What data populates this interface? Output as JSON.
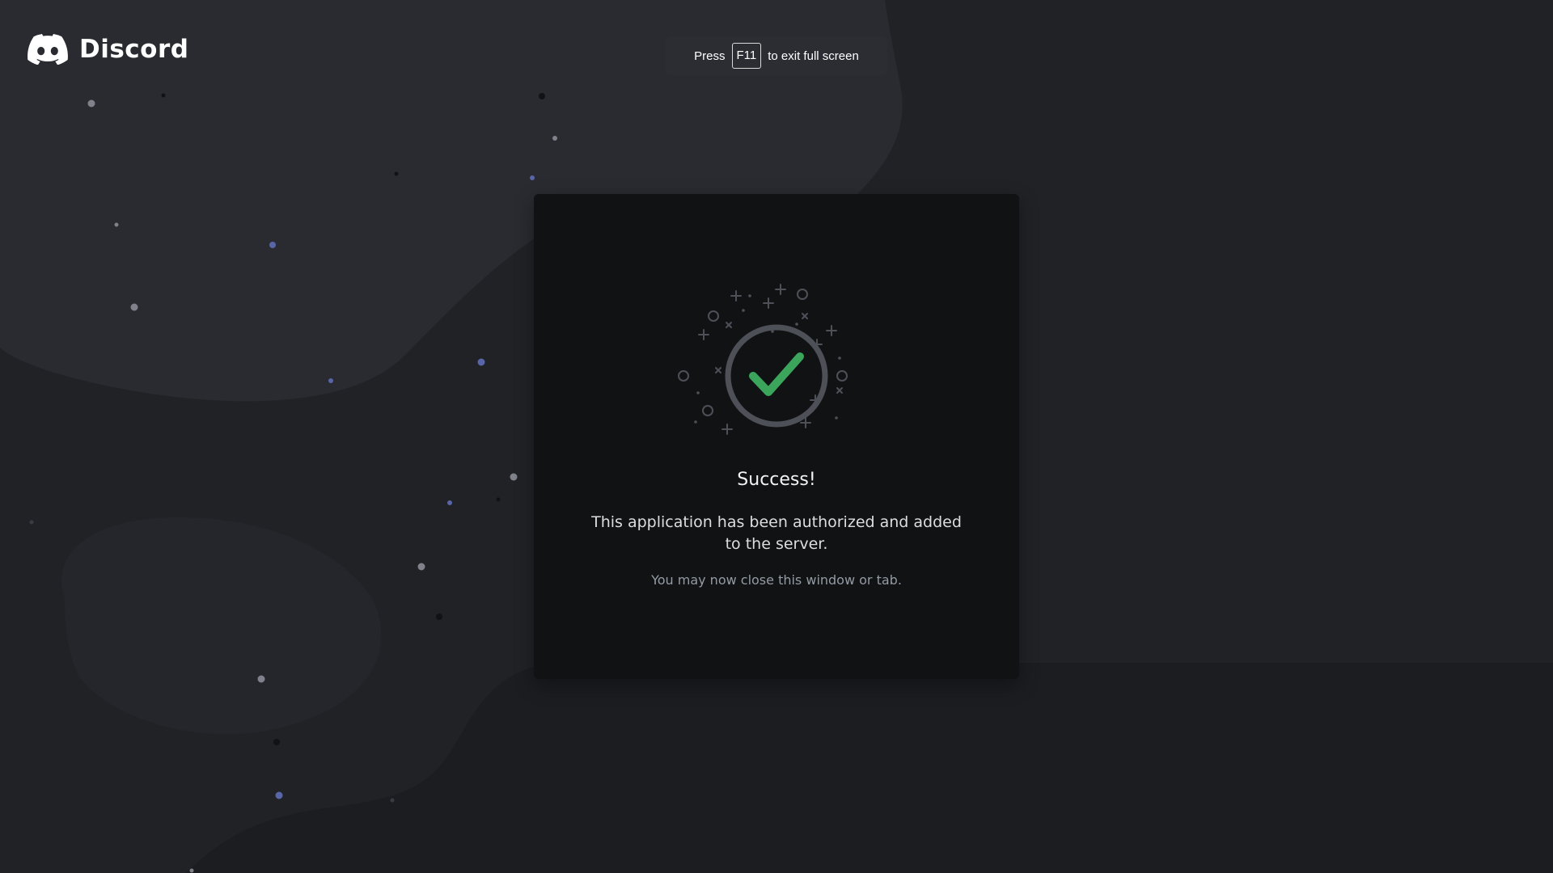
{
  "brand": {
    "name": "Discord"
  },
  "fullscreen_hint": {
    "prefix": "Press",
    "key": "F11",
    "suffix": "to exit full screen"
  },
  "dialog": {
    "title": "Success!",
    "message": "This application has been authorized and added to the server.",
    "note": "You may now close this window or tab."
  },
  "colors": {
    "background": "#202226",
    "card": "#111214",
    "success": "#3ba55c",
    "ring": "#4e5058"
  },
  "icons": {
    "logo": "discord-logo-icon",
    "status": "success-checkmark-icon"
  }
}
